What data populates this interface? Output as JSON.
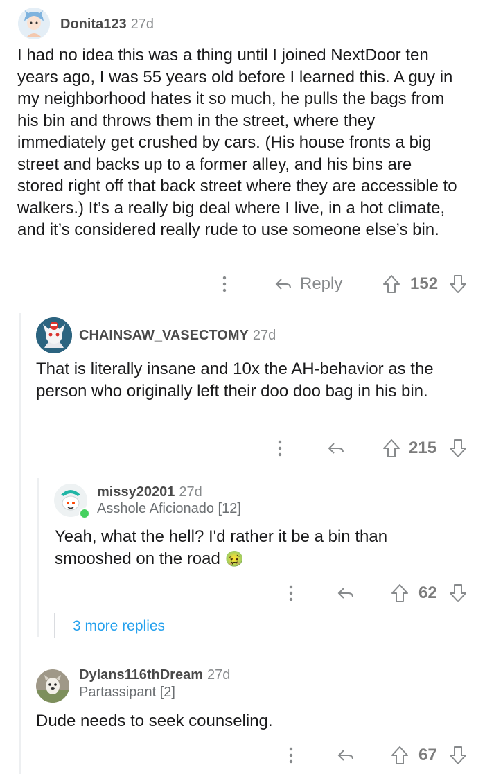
{
  "comments": [
    {
      "username": "Donita123",
      "time": "27d",
      "body": "I had no idea this was a thing until I joined NextDoor ten years ago, I was 55 years old before I learned this. A guy in my neighborhood hates it so much, he pulls the bags from his bin and throws them in the street, where they immediately get crushed by cars. (His house fronts a big street and backs up to a former alley, and his bins are stored right off that back street where they are accessible to walkers.) It’s a really big deal where I live, in a hot climate, and it’s considered really rude to use someone else’s bin.",
      "reply_label": "Reply",
      "score": "152"
    },
    {
      "username": "CHAINSAW_VASECTOMY",
      "time": "27d",
      "body": "That is literally insane and 10x the AH-behavior as the person who originally left their doo doo bag in his bin.",
      "score": "215"
    },
    {
      "username": "missy20201",
      "time": "27d",
      "flair": "Asshole Aficionado [12]",
      "body": "Yeah, what the hell? I'd rather it be a bin than smooshed on the road",
      "emoji": "🤢",
      "score": "62"
    },
    {
      "more_replies": "3 more replies"
    },
    {
      "username": "Dylans116thDream",
      "time": "27d",
      "flair": "Partassipant [2]",
      "body": "Dude needs to seek counseling.",
      "score": "67"
    }
  ],
  "colors": {
    "upvote_outline": "#878a8c",
    "link_blue": "#24a0ed",
    "online_green": "#46d160"
  },
  "icons": {
    "more": "more-options-icon",
    "reply": "reply-arrow-icon",
    "upvote": "upvote-arrow-icon",
    "downvote": "downvote-arrow-icon"
  }
}
